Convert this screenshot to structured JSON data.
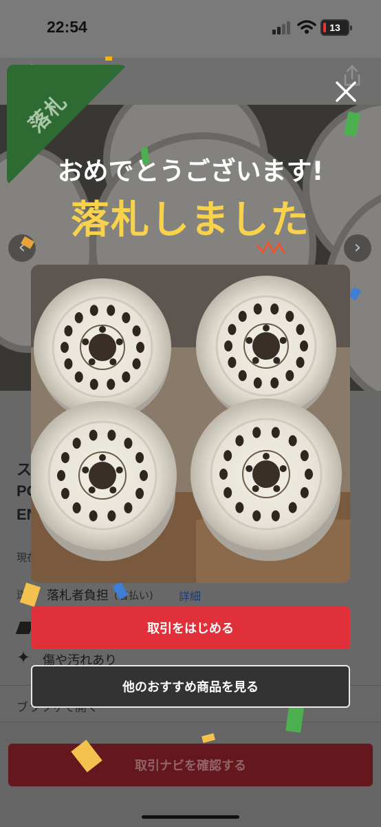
{
  "status_bar": {
    "time": "22:54",
    "battery": "13"
  },
  "modal": {
    "badge": "落札",
    "congrats": "おめでとうございます!",
    "title": "落札しました",
    "primary_button": "取引をはじめる",
    "secondary_button": "他のおすすめ商品を見る"
  },
  "page": {
    "title_lines": [
      "ス",
      "PO",
      "EN"
    ],
    "price_label": "現在",
    "shipping_label": "送料",
    "shipping_value": "落札者負担",
    "shipping_sub": "(着払い)",
    "shipping_link": "詳細",
    "condition": "傷や汚れあり",
    "browser_link": "ブラウザで開く",
    "nav_button": "取引ナビを確認する"
  },
  "colors": {
    "accent": "#e0303a",
    "badge_green": "#2e6b33",
    "won_yellow": "#f7d24a"
  }
}
